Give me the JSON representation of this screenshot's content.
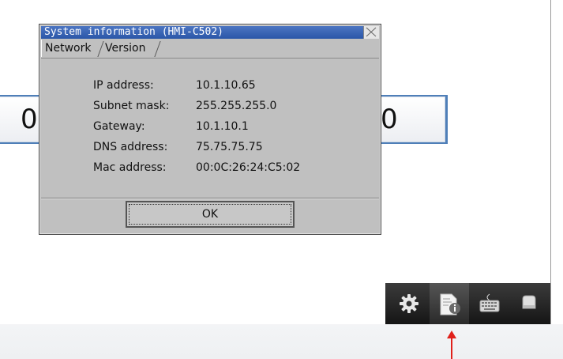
{
  "screen": {
    "value_left": "0",
    "value_right": "0"
  },
  "dialog": {
    "title": "System information (HMI-C502)",
    "tabs": [
      {
        "label": "Network",
        "active": true
      },
      {
        "label": "Version",
        "active": false
      }
    ],
    "network": [
      {
        "label": "IP address:",
        "value": "10.1.10.65"
      },
      {
        "label": "Subnet mask:",
        "value": "255.255.255.0"
      },
      {
        "label": "Gateway:",
        "value": "10.1.10.1"
      },
      {
        "label": "DNS address:",
        "value": "75.75.75.75"
      },
      {
        "label": "Mac address:",
        "value": "00:0C:26:24:C5:02"
      }
    ],
    "ok_label": "OK"
  },
  "taskbar": {
    "items": [
      {
        "icon": "gear-icon"
      },
      {
        "icon": "system-info-icon",
        "active": true
      },
      {
        "icon": "keyboard-icon"
      },
      {
        "icon": "storage-icon"
      }
    ]
  },
  "colors": {
    "titlebar": "#2a56a8",
    "dialog_bg": "#c0c0c0",
    "value_border": "#4f7fb8",
    "arrow": "#e0201a"
  }
}
